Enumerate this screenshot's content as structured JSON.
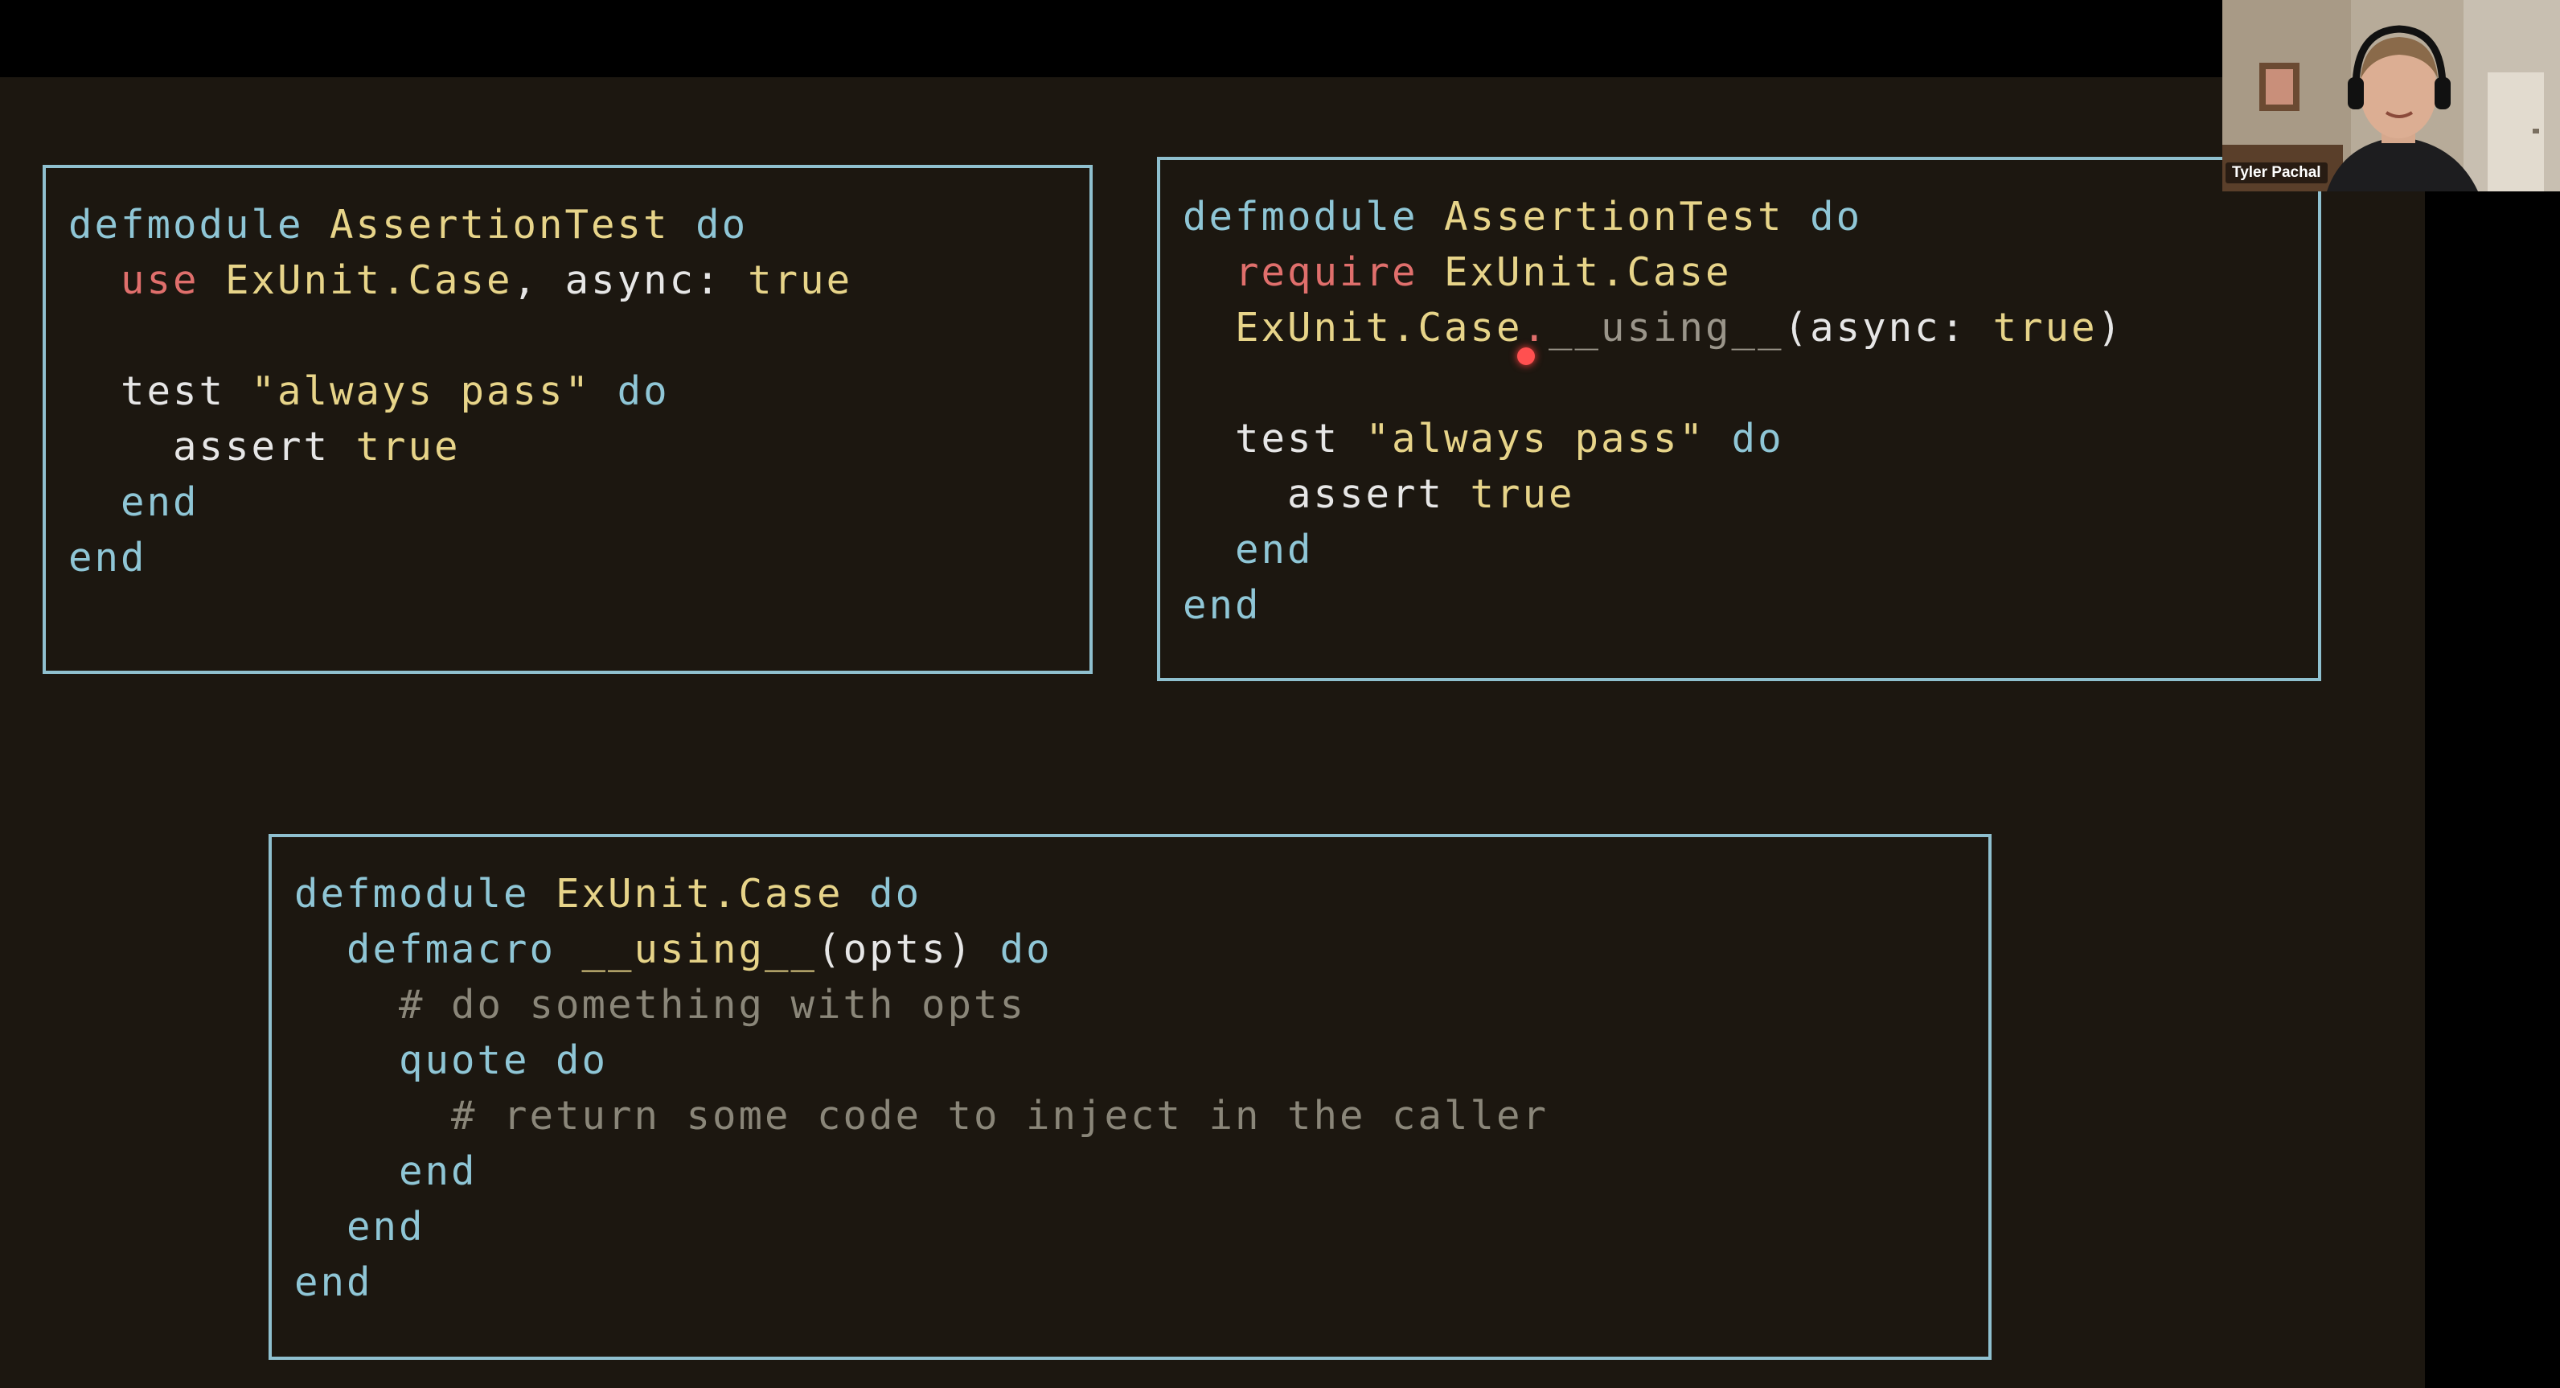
{
  "colors": {
    "slide_background": "#1c1710",
    "box_border": "#8fc0cf",
    "keyword": "#8fc6d6",
    "module": "#e7d489",
    "macro_call": "#e06f6c",
    "comment": "#8a8679",
    "laser_pointer": "#ff5050"
  },
  "webcam": {
    "participant_name": "Tyler Pachal"
  },
  "box1": {
    "line1": {
      "kw_defmodule": "defmodule",
      "module": "AssertionTest",
      "kw_do": "do"
    },
    "line2": {
      "kw_use": "use",
      "module": "ExUnit.Case",
      "rest": ", async:",
      "kw_true": "true"
    },
    "line4": {
      "text_test": "test",
      "string": "\"always pass\"",
      "kw_do": "do"
    },
    "line5": {
      "text_assert": "assert",
      "kw_true": "true"
    },
    "line6": {
      "kw_end": "end"
    },
    "line7": {
      "kw_end": "end"
    }
  },
  "box2": {
    "line1": {
      "kw_defmodule": "defmodule",
      "module": "AssertionTest",
      "kw_do": "do"
    },
    "line2": {
      "kw_require": "require",
      "module": "ExUnit.Case"
    },
    "line3": {
      "module": "ExUnit.Case",
      "dot": ".",
      "using": "__using__",
      "open": "(async:",
      "kw_true": "true",
      "close": ")"
    },
    "line5": {
      "text_test": "test",
      "string": "\"always pass\"",
      "kw_do": "do"
    },
    "line6": {
      "text_assert": "assert",
      "kw_true": "true"
    },
    "line7": {
      "kw_end": "end"
    },
    "line8": {
      "kw_end": "end"
    }
  },
  "box3": {
    "line1": {
      "kw_defmodule": "defmodule",
      "module": "ExUnit.Case",
      "kw_do": "do"
    },
    "line2": {
      "kw_defmacro": "defmacro",
      "using": "__using__",
      "args": "(opts)",
      "kw_do": "do"
    },
    "line3": {
      "comment": "# do something with opts"
    },
    "line4": {
      "kw_quote": "quote",
      "kw_do": "do"
    },
    "line5": {
      "comment": "# return some code to inject in the caller"
    },
    "line6": {
      "kw_end": "end"
    },
    "line7": {
      "kw_end": "end"
    },
    "line8": {
      "kw_end": "end"
    }
  }
}
